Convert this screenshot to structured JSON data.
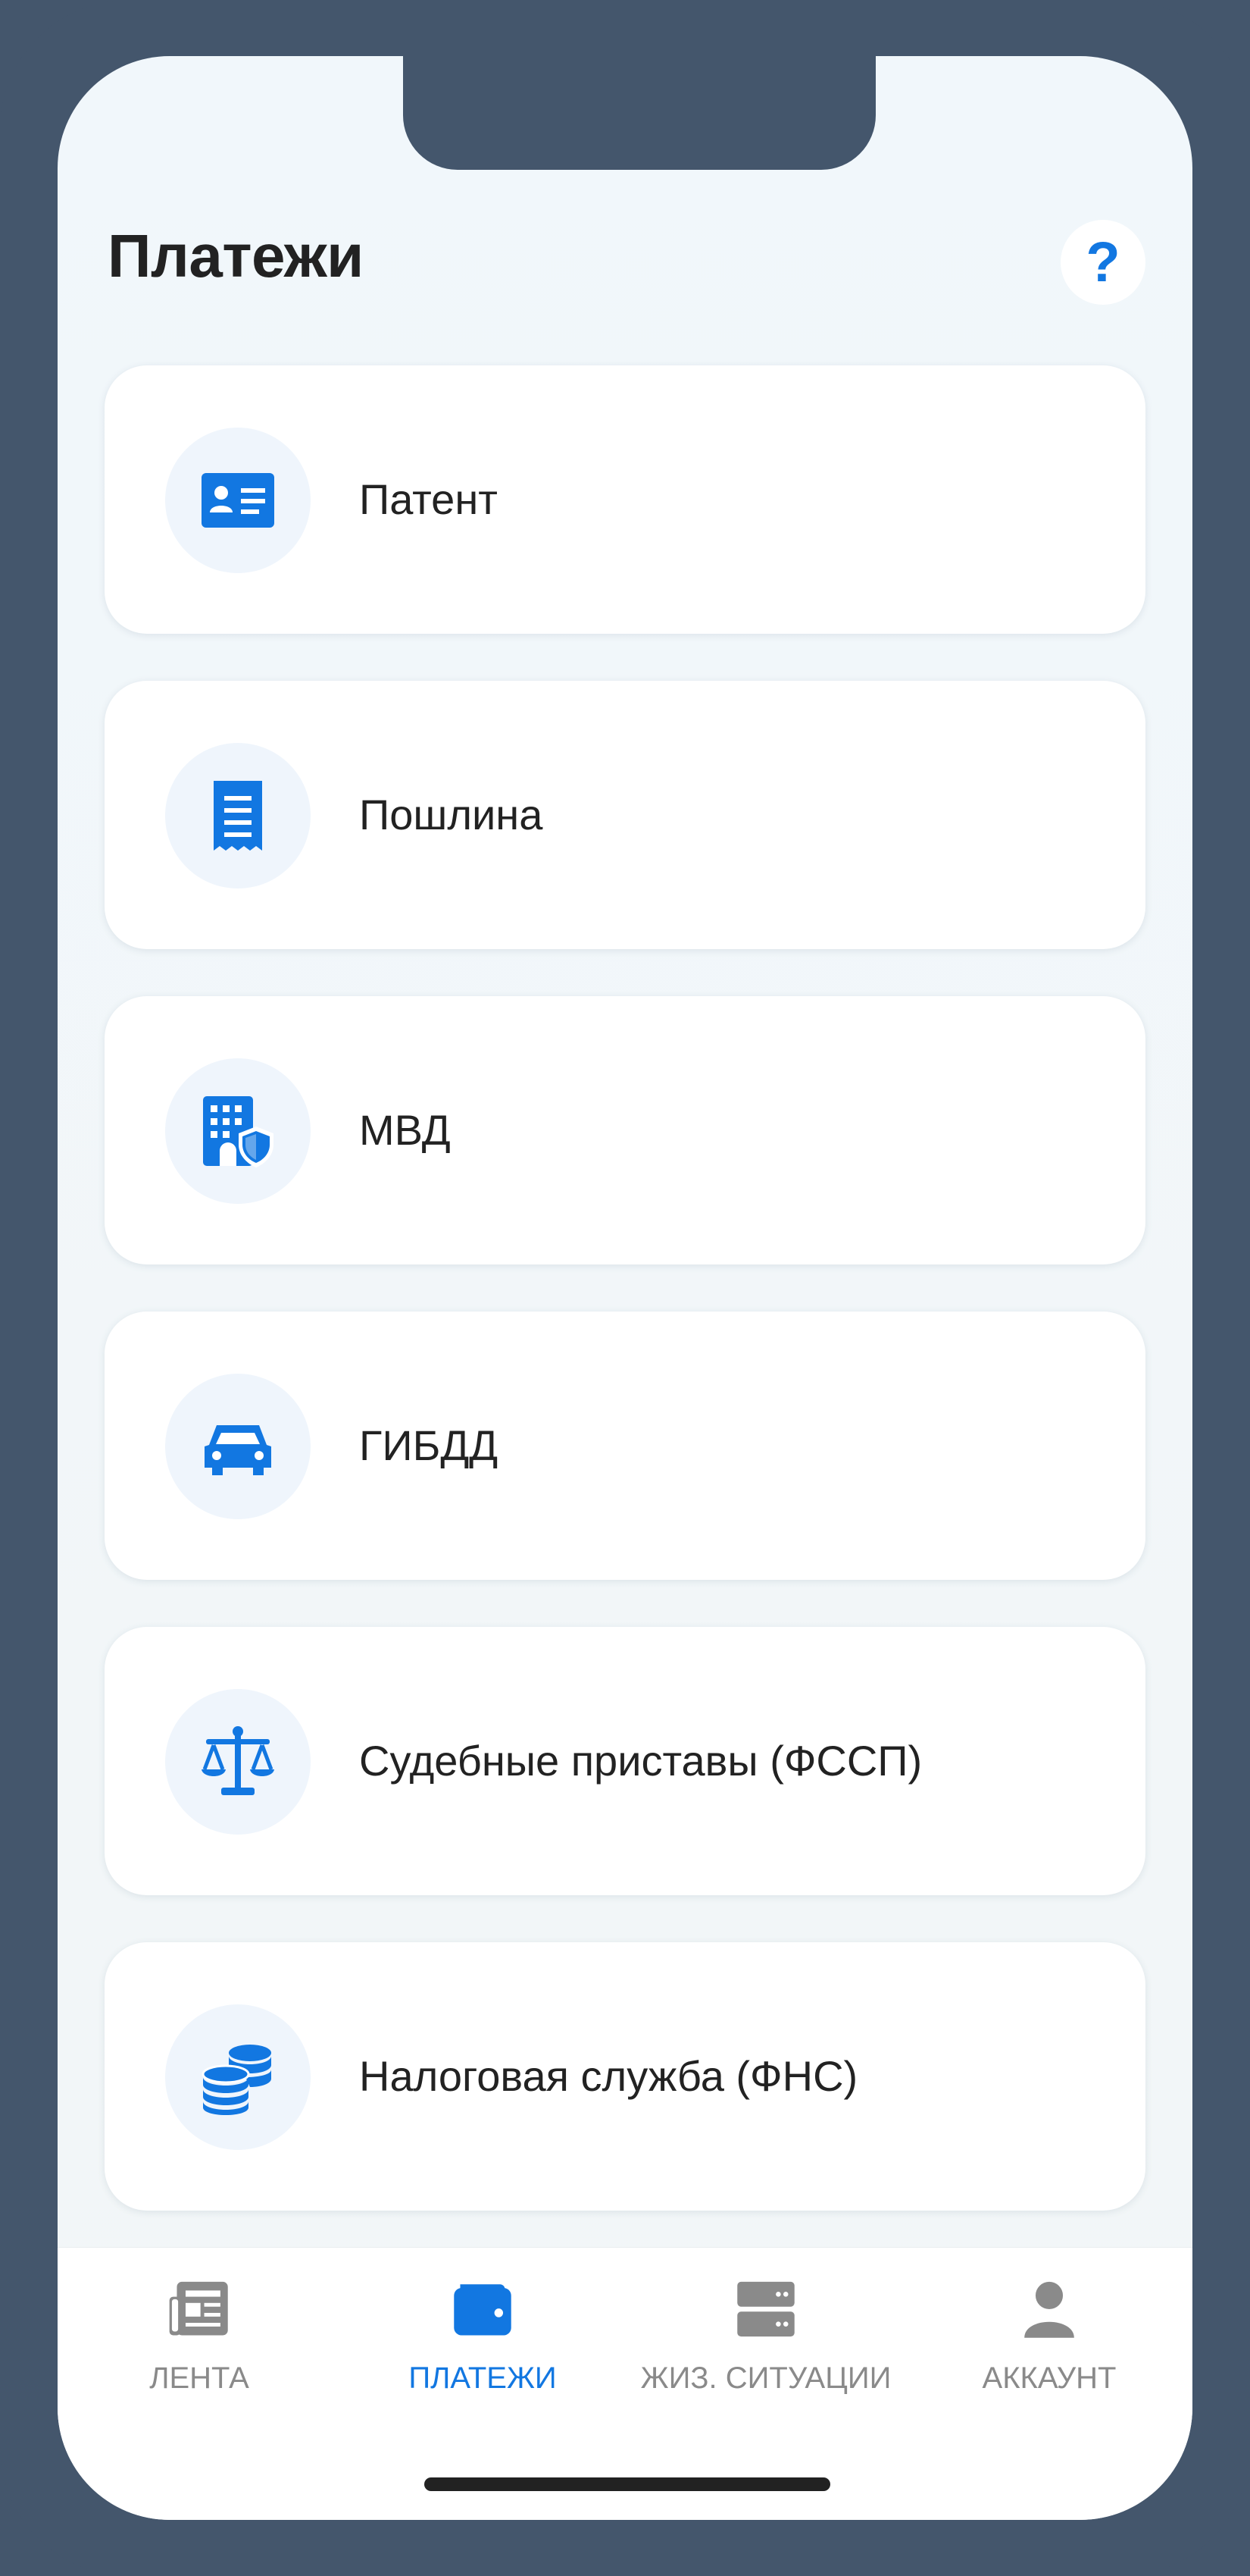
{
  "page": {
    "title": "Платежи",
    "help_label": "?"
  },
  "colors": {
    "accent": "#1277e1",
    "inactive": "#8a8a8a",
    "frame": "#44566c"
  },
  "categories": [
    {
      "label": "Патент",
      "icon": "id-card-icon"
    },
    {
      "label": "Пошлина",
      "icon": "receipt-icon"
    },
    {
      "label": "МВД",
      "icon": "building-shield-icon"
    },
    {
      "label": "ГИБДД",
      "icon": "car-icon"
    },
    {
      "label": "Судебные приставы (ФССП)",
      "icon": "scales-icon"
    },
    {
      "label": "Налоговая служба (ФНС)",
      "icon": "coins-icon"
    }
  ],
  "tabbar": {
    "items": [
      {
        "label": "ЛЕНТА",
        "icon": "newspaper-icon",
        "active": false
      },
      {
        "label": "ПЛАТЕЖИ",
        "icon": "wallet-icon",
        "active": true
      },
      {
        "label": "ЖИЗ. СИТУАЦИИ",
        "icon": "server-icon",
        "active": false
      },
      {
        "label": "АККАУНТ",
        "icon": "user-icon",
        "active": false
      }
    ]
  }
}
